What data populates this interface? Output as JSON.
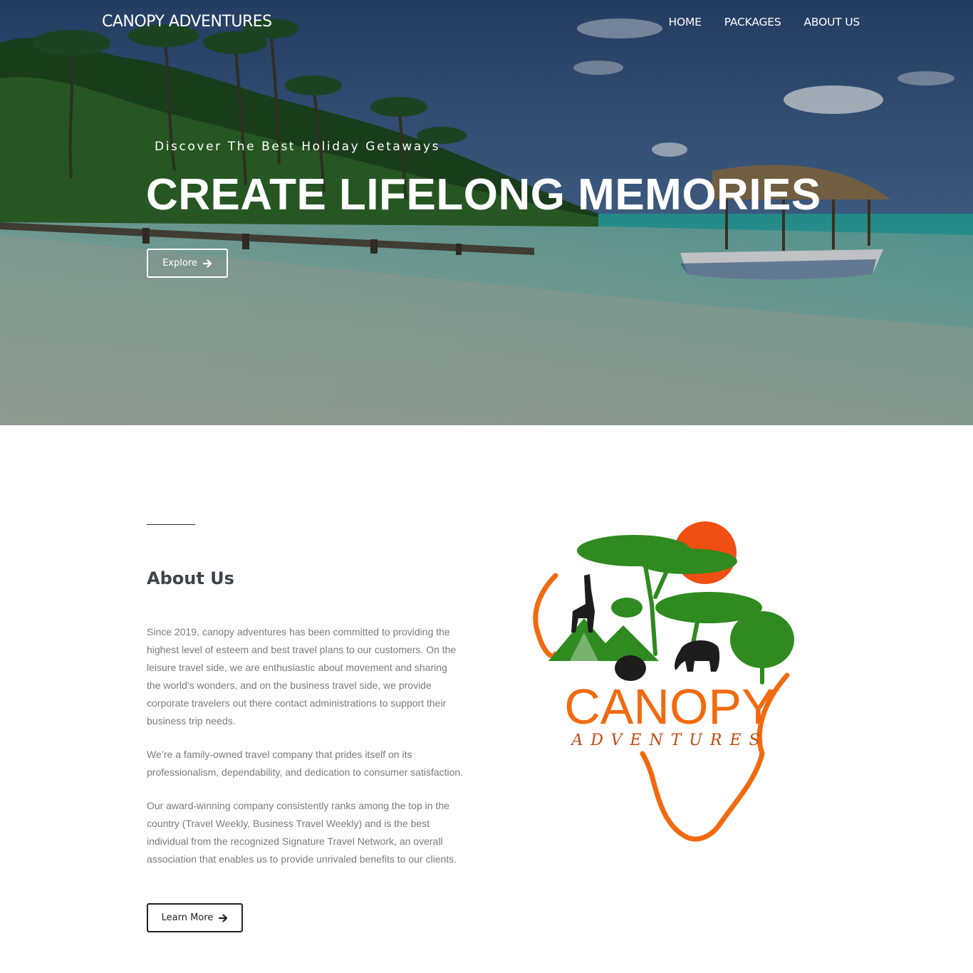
{
  "nav": {
    "brand": "CANOPY ADVENTURES",
    "items": [
      {
        "label": "HOME"
      },
      {
        "label": "PACKAGES"
      },
      {
        "label": "ABOUT US"
      }
    ]
  },
  "hero": {
    "subtitle": "Discover The Best Holiday Getaways",
    "title": "CREATE LIFELONG MEMORIES",
    "cta_label": "Explore",
    "cta_icon": "arrow-right-icon"
  },
  "about": {
    "title": "About Us",
    "paragraphs": [
      "Since 2019, canopy adventures has been committed to providing the highest level of esteem and best travel plans to our customers. On the leisure travel side, we are enthusiastic about movement and sharing the world’s wonders, and on the business travel side, we provide corporate travelers out there contact administrations to support their business trip needs.",
      "We’re a family-owned travel company that prides itself on its professionalism, dependability, and dedication to consumer satisfaction.",
      "Our award-winning company consistently ranks among the top in the country (Travel Weekly, Business Travel Weekly) and is the best individual from the recognized Signature Travel Network, an overall association that enables us to provide unrivaled benefits to our clients."
    ],
    "cta_label": "Learn More",
    "cta_icon": "arrow-right-icon"
  },
  "logo": {
    "name": "CANOPY",
    "tagline": "ADVENTURES"
  },
  "colors": {
    "brand_orange": "#f26a10",
    "brand_green": "#2f8a1f",
    "heading": "#3d454c",
    "body_text": "#7a7a7a"
  }
}
